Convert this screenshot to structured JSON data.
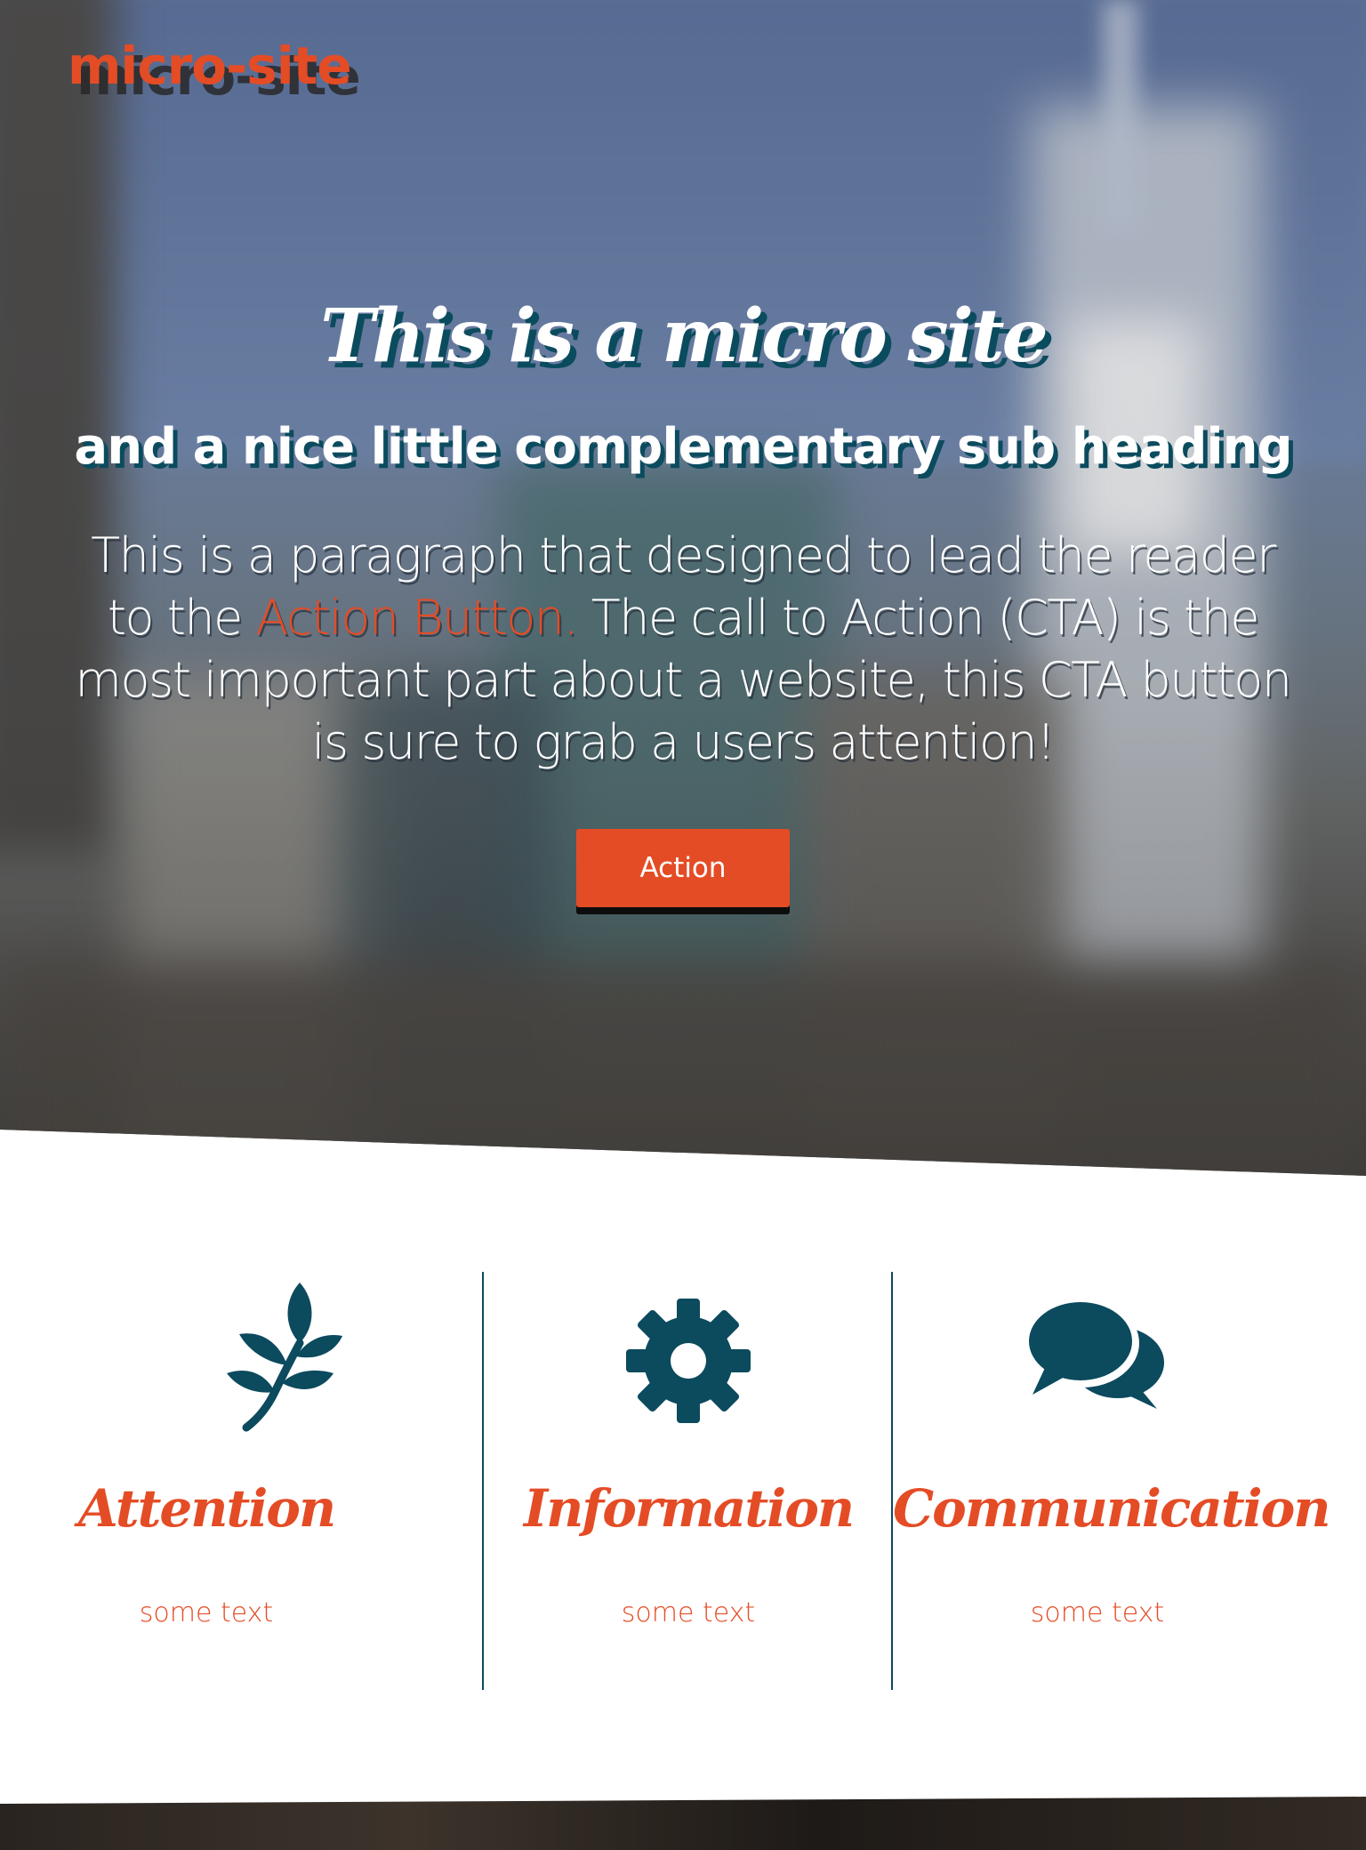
{
  "header": {
    "logo": "micro-site"
  },
  "hero": {
    "title": "This is a micro site",
    "subtitle": "and a nice little complementary sub heading",
    "paragraph_before": "This is a paragraph that designed to lead the reader to the ",
    "paragraph_link": "Action Button.",
    "paragraph_after": " The call to Action (CTA) is the most important part about a website, this CTA button is sure to grab a users attention!",
    "button_label": "Action"
  },
  "features": [
    {
      "icon": "leaf-icon",
      "title": "Attention",
      "text": "some text"
    },
    {
      "icon": "gear-icon",
      "title": "Information",
      "text": "some text"
    },
    {
      "icon": "chat-bubbles-icon",
      "title": "Communication",
      "text": "some text"
    }
  ],
  "colors": {
    "accent": "#e44c26",
    "dark_teal": "#0c4a5e",
    "white": "#ffffff"
  }
}
